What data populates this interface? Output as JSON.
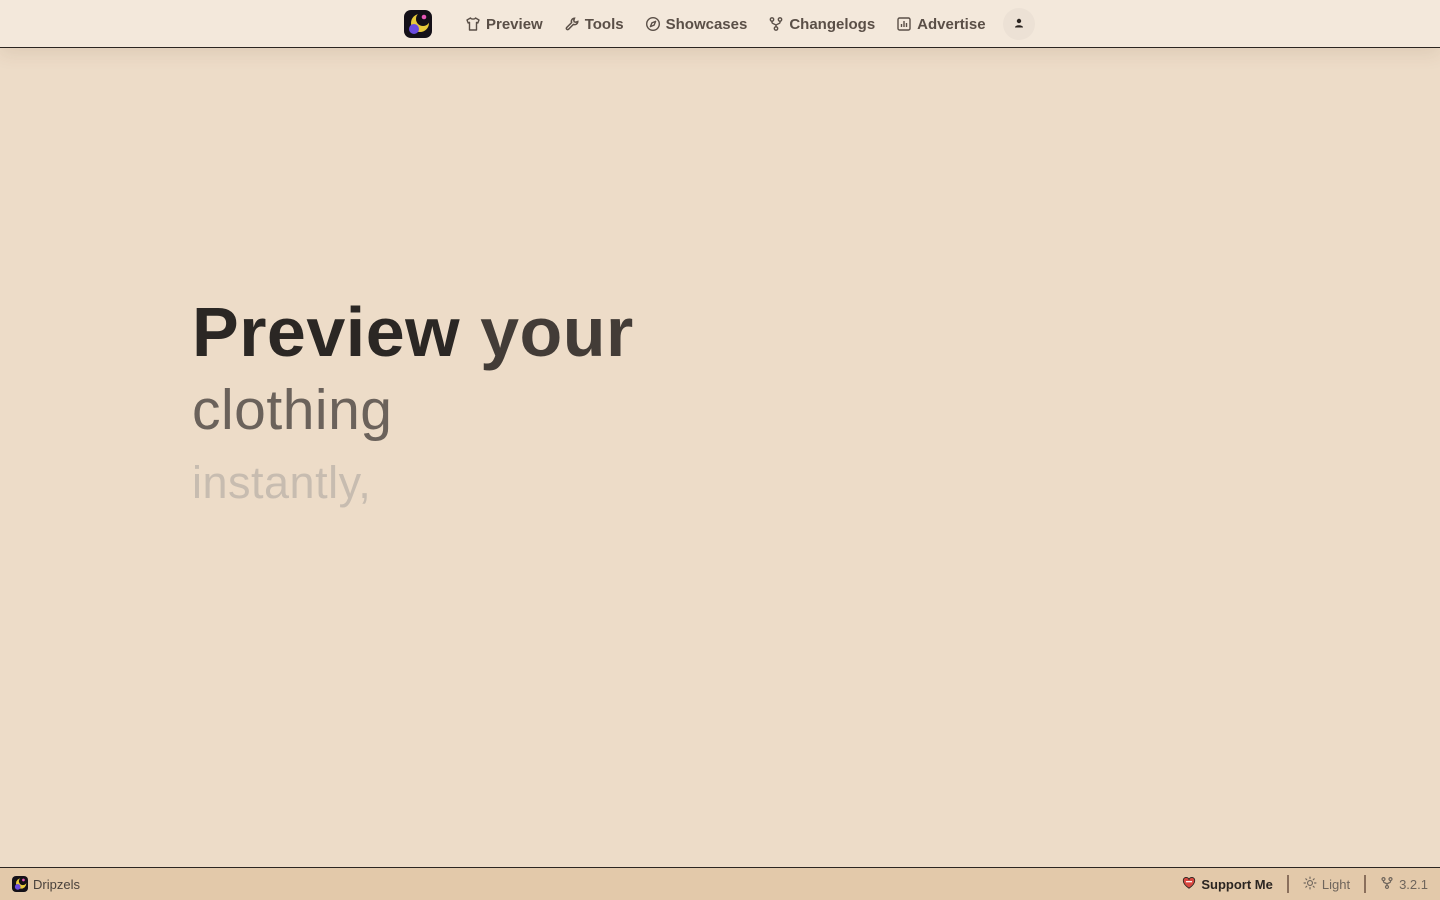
{
  "header": {
    "logo_icon": "app-logo-icon",
    "nav": [
      {
        "label": "Preview",
        "icon": "shirt-icon"
      },
      {
        "label": "Tools",
        "icon": "wrench-icon"
      },
      {
        "label": "Showcases",
        "icon": "compass-icon"
      },
      {
        "label": "Changelogs",
        "icon": "git-branch-icon"
      },
      {
        "label": "Advertise",
        "icon": "bar-chart-icon"
      }
    ],
    "user_icon": "user-icon"
  },
  "hero": {
    "line1_word1": "Preview",
    "line1_word2": "your",
    "line2": "clothing",
    "line3": "instantly,"
  },
  "footer": {
    "brand_name": "Dripzels",
    "support_label": "Support Me",
    "theme_label": "Light",
    "version": "3.2.1"
  },
  "colors": {
    "background": "#eddcc8",
    "topbar": "#f3e8db",
    "footer": "#e3c9aa",
    "text_dark": "#2b2521",
    "text_faded": "#c7bcb0",
    "heart": "#d8473f"
  }
}
